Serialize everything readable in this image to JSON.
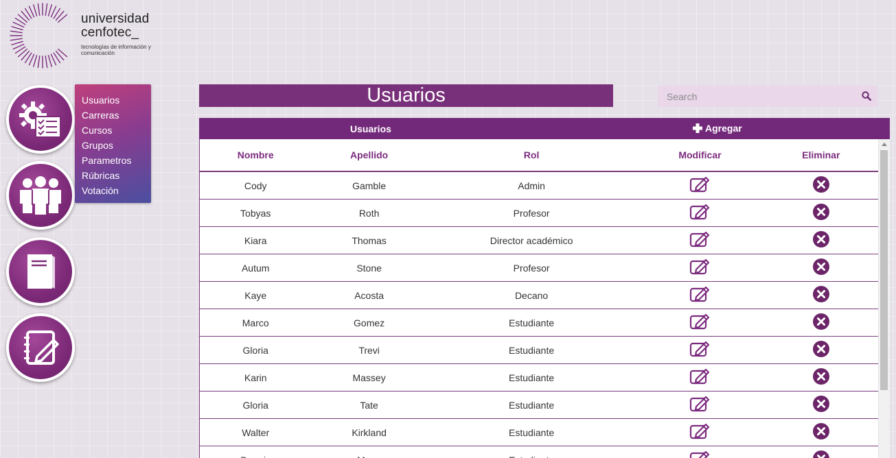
{
  "brand": {
    "name_line1": "universidad",
    "name_line2": "cenfotec_",
    "tagline": "tecnologías de información y comunicación"
  },
  "sidebar_icons": [
    {
      "name": "admin-settings-icon"
    },
    {
      "name": "users-group-icon"
    },
    {
      "name": "book-icon"
    },
    {
      "name": "edit-notebook-icon"
    }
  ],
  "menu": {
    "items": [
      "Usuarios",
      "Carreras",
      "Cursos",
      "Grupos",
      "Parametros",
      "Rúbricas",
      "Votación"
    ]
  },
  "page_title": "Usuarios",
  "search": {
    "placeholder": "Search",
    "icon": "search-icon"
  },
  "table": {
    "caption": "Usuarios",
    "add_label": "Agregar",
    "columns": [
      "Nombre",
      "Apellido",
      "Rol",
      "Modificar",
      "Eliminar"
    ],
    "rows": [
      {
        "nombre": "Cody",
        "apellido": "Gamble",
        "rol": "Admin"
      },
      {
        "nombre": "Tobyas",
        "apellido": "Roth",
        "rol": "Profesor"
      },
      {
        "nombre": "Kiara",
        "apellido": "Thomas",
        "rol": "Director académico"
      },
      {
        "nombre": "Autum",
        "apellido": "Stone",
        "rol": "Profesor"
      },
      {
        "nombre": "Kaye",
        "apellido": "Acosta",
        "rol": "Decano"
      },
      {
        "nombre": "Marco",
        "apellido": "Gomez",
        "rol": "Estudiante"
      },
      {
        "nombre": "Gloria",
        "apellido": "Trevi",
        "rol": "Estudiante"
      },
      {
        "nombre": "Karin",
        "apellido": "Massey",
        "rol": "Estudiante"
      },
      {
        "nombre": "Gloria",
        "apellido": "Tate",
        "rol": "Estudiante"
      },
      {
        "nombre": "Walter",
        "apellido": "Kirkland",
        "rol": "Estudiante"
      },
      {
        "nombre": "Dennis",
        "apellido": "Moon",
        "rol": "Estudiante"
      }
    ]
  },
  "colors": {
    "primary": "#73297a",
    "accent": "#7b2b7e",
    "search_bg": "#ead7ea"
  }
}
